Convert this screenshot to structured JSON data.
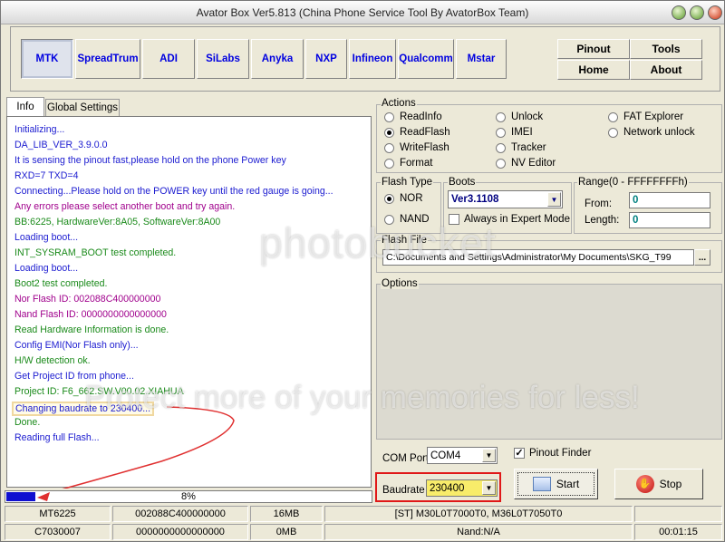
{
  "title": "Avator Box Ver5.813 (China Phone Service Tool By AvatorBox Team)",
  "manufacturers": [
    "MTK",
    "SpreadTrum",
    "ADI",
    "SiLabs",
    "Anyka",
    "NXP",
    "Infineon",
    "Qualcomm",
    "Mstar"
  ],
  "topbuttons": {
    "pinout": "Pinout",
    "tools": "Tools",
    "home": "Home",
    "about": "About"
  },
  "tabs": {
    "info": "Info",
    "global": "Global Settings"
  },
  "log": [
    {
      "text": "Initializing...",
      "color": "#1b1bd0"
    },
    {
      "text": "DA_LIB_VER_3.9.0.0",
      "color": "#1b1bd0"
    },
    {
      "text": "It is sensing the pinout fast,please hold on the phone Power key",
      "color": "#1b1bd0"
    },
    {
      "text": "RXD=7  TXD=4",
      "color": "#1b1bd0"
    },
    {
      "text": "Connecting...Please hold on the POWER key until the red gauge is going...",
      "color": "#1b1bd0"
    },
    {
      "text": "Any errors please select another boot and try again.",
      "color": "#a0008c"
    },
    {
      "text": "BB:6225,    HardwareVer:8A05,    SoftwareVer:8A00",
      "color": "#1a8a1a"
    },
    {
      "text": "Loading boot...",
      "color": "#1b1bd0"
    },
    {
      "text": "INT_SYSRAM_BOOT test completed.",
      "color": "#1a8a1a"
    },
    {
      "text": "Loading boot...",
      "color": "#1b1bd0"
    },
    {
      "text": "Boot2 test completed.",
      "color": "#1a8a1a"
    },
    {
      "text": "Nor Flash ID: 002088C400000000",
      "color": "#a0008c"
    },
    {
      "text": "Nand Flash ID: 0000000000000000",
      "color": "#a0008c"
    },
    {
      "text": "Read Hardware Information is done.",
      "color": "#1a8a1a"
    },
    {
      "text": "Config EMI(Nor Flash only)...",
      "color": "#1b1bd0"
    },
    {
      "text": "H/W detection ok.",
      "color": "#1a8a1a"
    },
    {
      "text": "Get Project ID from phone...",
      "color": "#1b1bd0"
    },
    {
      "text": "Project ID: F6_662.SW.V00.02.XIAHUA",
      "color": "#1a8a1a"
    },
    {
      "text": "Changing baudrate to 230400...",
      "color": "#1b1bd0"
    },
    {
      "text": "Done.",
      "color": "#1a8a1a"
    },
    {
      "text": "Reading full Flash...",
      "color": "#1b1bd0"
    }
  ],
  "progress": {
    "label": "8%",
    "value": 0.08
  },
  "actions": {
    "label": "Actions",
    "items": [
      "ReadInfo",
      "Unlock",
      "FAT Explorer",
      "ReadFlash",
      "IMEI",
      "Network unlock",
      "WriteFlash",
      "Tracker",
      "Format",
      "NV Editor"
    ],
    "selected": "ReadFlash"
  },
  "flash_type": {
    "label": "Flash Type",
    "nor": "NOR",
    "nand": "NAND",
    "selected": "NOR"
  },
  "boots": {
    "label": "Boots",
    "value": "Ver3.1108",
    "expert": "Always in Expert Mode"
  },
  "range": {
    "label": "Range(0 - FFFFFFFFh)",
    "from_label": "From:",
    "from": "0",
    "length_label": "Length:",
    "length": "0"
  },
  "flash_file": {
    "label": "Flash File",
    "path": "C:\\Documents and Settings\\Administrator\\My Documents\\SKG_T99",
    "browse": "..."
  },
  "options": {
    "label": "Options"
  },
  "com": {
    "label": "COM Port",
    "value": "COM4",
    "pinout_finder": "Pinout Finder"
  },
  "baud": {
    "label": "Baudrate",
    "value": "230400"
  },
  "buttons": {
    "start": "Start",
    "stop": "Stop"
  },
  "status": {
    "row1": [
      "MT6225",
      "002088C400000000",
      "16MB",
      "[ST] M30L0T7000T0, M36L0T7050T0",
      ""
    ],
    "row2": [
      "C7030007",
      "0000000000000000",
      "0MB",
      "Nand:N/A",
      "00:01:15"
    ]
  },
  "watermark": {
    "line1": "photobucket",
    "line2": "Protect more of your memories for less!"
  }
}
